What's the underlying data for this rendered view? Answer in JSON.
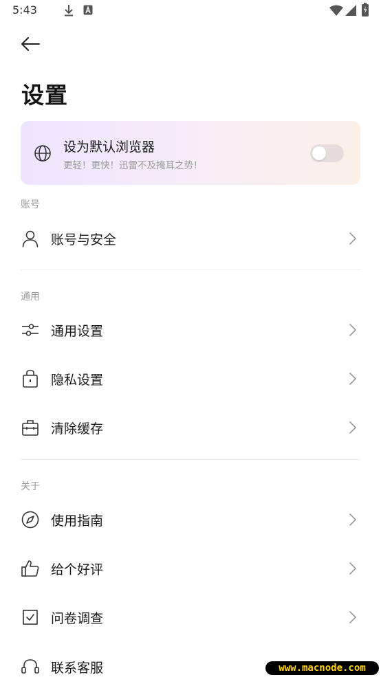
{
  "status_bar": {
    "time": "5:43",
    "left_icons": [
      "download-icon",
      "a-badge-icon"
    ],
    "right_icons": [
      "wifi-icon",
      "signal-icon",
      "battery-icon"
    ]
  },
  "header": {
    "back_icon": "arrow-left-icon",
    "title": "设置"
  },
  "banner": {
    "icon": "globe-icon",
    "title": "设为默认浏览器",
    "subtitle": "更轻！更快！迅雷不及掩耳之势！",
    "toggle_on": false
  },
  "sections": {
    "account": {
      "label": "账号",
      "items": [
        {
          "label": "账号与安全",
          "icon": "user-icon"
        }
      ]
    },
    "general": {
      "label": "通用",
      "items": [
        {
          "label": "通用设置",
          "icon": "sliders-icon"
        },
        {
          "label": "隐私设置",
          "icon": "lock-bag-icon"
        },
        {
          "label": "清除缓存",
          "icon": "briefcase-icon"
        }
      ]
    },
    "about": {
      "label": "关于",
      "items": [
        {
          "label": "使用指南",
          "icon": "compass-icon"
        },
        {
          "label": "给个好评",
          "icon": "thumbs-up-icon"
        },
        {
          "label": "问卷调查",
          "icon": "checkbox-icon"
        },
        {
          "label": "联系客服",
          "icon": "headset-icon"
        }
      ]
    }
  },
  "watermark": "www.macnode.com",
  "colors": {
    "banner_gradient_start": "#efe4ff",
    "banner_gradient_end": "#fbf0e8",
    "toggle_off": "#e6dcdc",
    "secondary_text": "#9a9a9a",
    "watermark_text": "#ffd400"
  }
}
